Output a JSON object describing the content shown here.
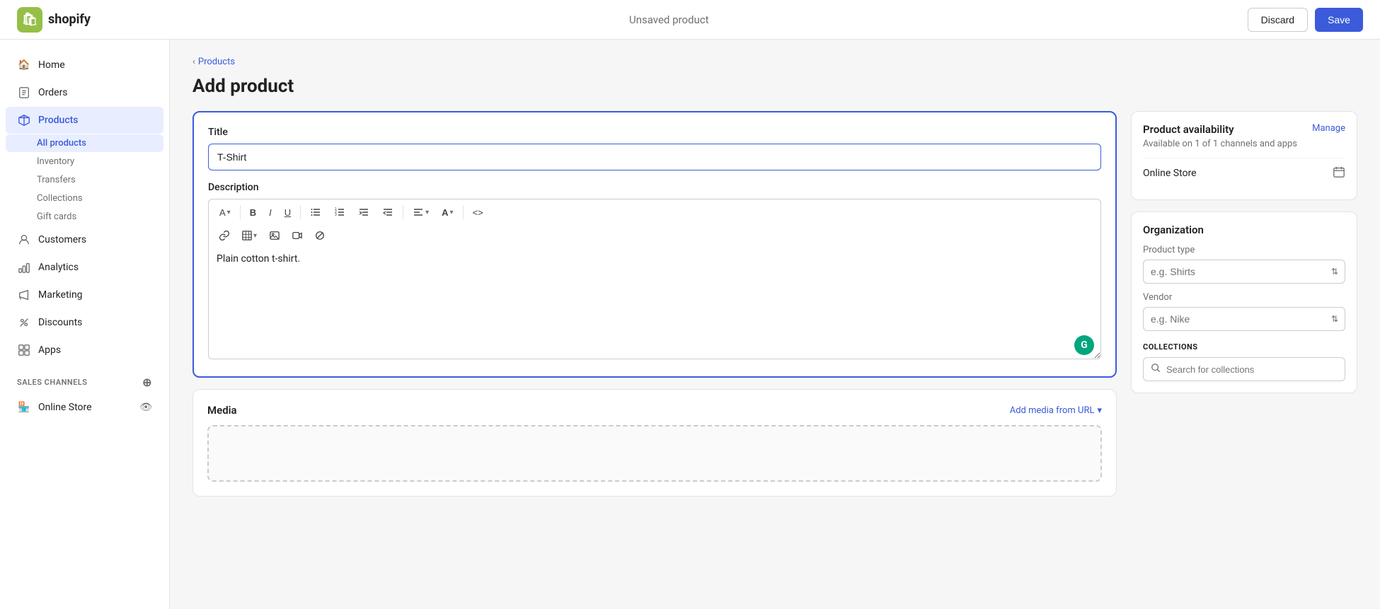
{
  "topbar": {
    "logo_text": "shopify",
    "page_status": "Unsaved product",
    "discard_label": "Discard",
    "save_label": "Save"
  },
  "sidebar": {
    "items": [
      {
        "id": "home",
        "label": "Home",
        "icon": "🏠"
      },
      {
        "id": "orders",
        "label": "Orders",
        "icon": "📋"
      },
      {
        "id": "products",
        "label": "Products",
        "icon": "🏷️",
        "active": true
      }
    ],
    "sub_items": [
      {
        "id": "all-products",
        "label": "All products",
        "active": true
      },
      {
        "id": "inventory",
        "label": "Inventory"
      },
      {
        "id": "transfers",
        "label": "Transfers"
      },
      {
        "id": "collections",
        "label": "Collections"
      },
      {
        "id": "gift-cards",
        "label": "Gift cards"
      }
    ],
    "lower_items": [
      {
        "id": "customers",
        "label": "Customers",
        "icon": "👤"
      },
      {
        "id": "analytics",
        "label": "Analytics",
        "icon": "📊"
      },
      {
        "id": "marketing",
        "label": "Marketing",
        "icon": "📣"
      },
      {
        "id": "discounts",
        "label": "Discounts",
        "icon": "🏷️"
      },
      {
        "id": "apps",
        "label": "Apps",
        "icon": "⊞"
      }
    ],
    "sales_channels_label": "SALES CHANNELS",
    "online_store_label": "Online Store"
  },
  "breadcrumb": {
    "back_label": "Products"
  },
  "page": {
    "title": "Add product"
  },
  "product_form": {
    "title_label": "Title",
    "title_value": "T-Shirt",
    "description_label": "Description",
    "description_value": "Plain cotton t-shirt.",
    "toolbar_buttons": [
      "A",
      "B",
      "I",
      "U",
      "≡",
      "≡",
      "⊳",
      "⊲",
      "▤",
      "A"
    ],
    "toolbar_code": "<>",
    "toolbar2_buttons": [
      "🔗",
      "▦",
      "🖼",
      "🎬",
      "⊘"
    ]
  },
  "media": {
    "title": "Media",
    "add_media_label": "Add media from URL"
  },
  "right_panel": {
    "availability": {
      "title": "Product availability",
      "manage_label": "Manage",
      "subtitle": "Available on 1 of 1 channels and apps",
      "channel": "Online Store"
    },
    "organization": {
      "title": "Organization",
      "product_type_label": "Product type",
      "product_type_placeholder": "e.g. Shirts",
      "vendor_label": "Vendor",
      "vendor_placeholder": "e.g. Nike",
      "collections_label": "COLLECTIONS",
      "collections_search_placeholder": "Search for collections"
    }
  }
}
